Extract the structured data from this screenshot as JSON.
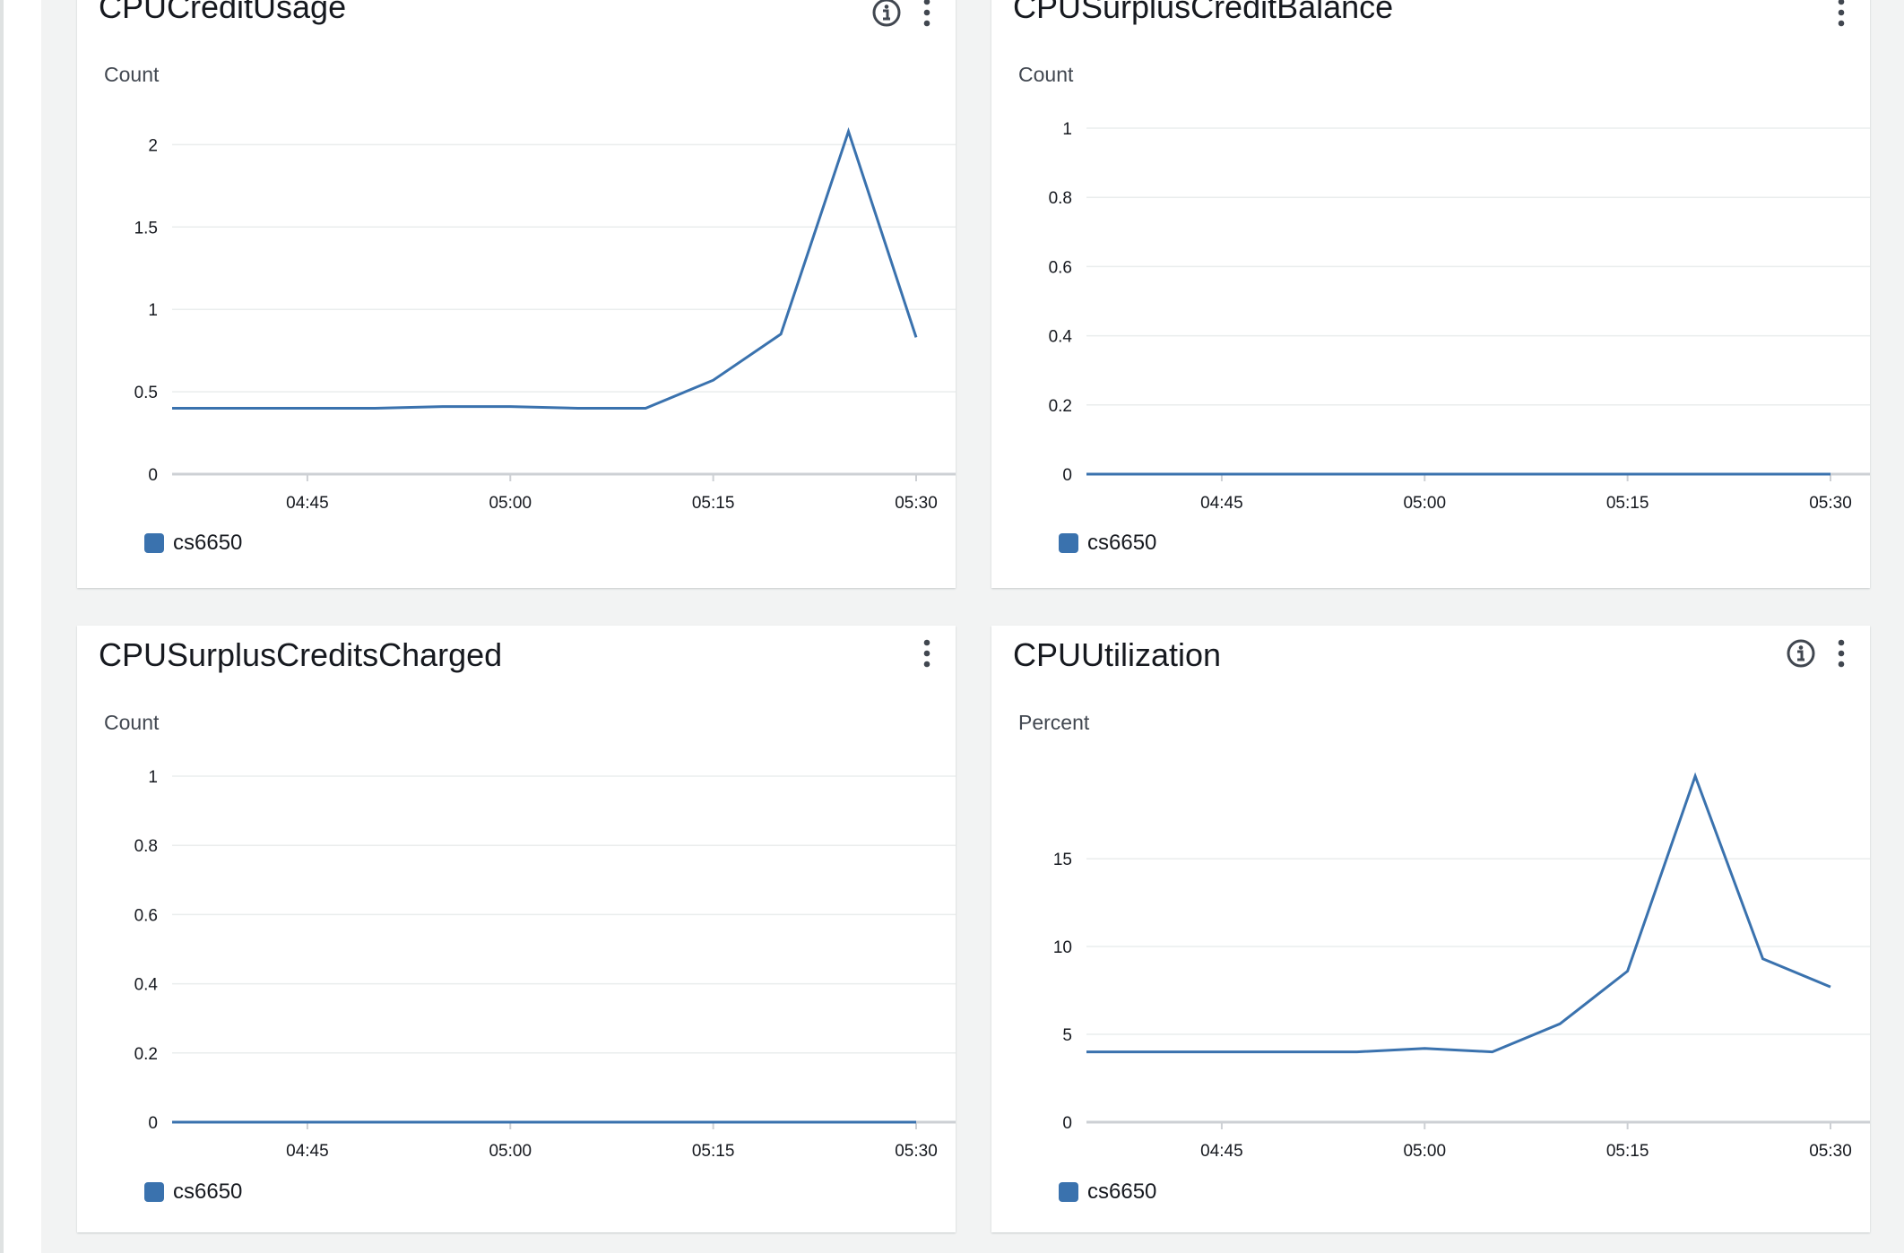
{
  "colors": {
    "series": "#3a72ae",
    "grid": "#eaeded",
    "baseline": "#cdd0d4",
    "text": "#16191f",
    "muted": "#414750"
  },
  "icons": {
    "info": "info-icon",
    "menu": "vertical-ellipsis-icon"
  },
  "widgets": [
    {
      "title": "CPUCreditUsage",
      "has_info": true,
      "legend": "cs6650",
      "chart_data": {
        "type": "line",
        "ylabel": "Count",
        "ylim": [
          0,
          2.1
        ],
        "yticks": [
          0,
          0.5,
          1,
          1.5,
          2
        ],
        "ytick_labels": [
          "0",
          "0.5",
          "1",
          "1.5",
          "2"
        ],
        "xlim": [
          "04:35",
          "04:55"
        ],
        "xticks": [
          "04:45",
          "05:00",
          "05:15",
          "05:30"
        ],
        "series": [
          {
            "name": "cs6650",
            "x": [
              "04:35",
              "04:40",
              "04:45",
              "04:50",
              "04:55",
              "05:00",
              "05:05",
              "05:10",
              "05:15",
              "05:20",
              "05:25",
              "05:30"
            ],
            "values": [
              0.4,
              0.4,
              0.4,
              0.4,
              0.41,
              0.41,
              0.4,
              0.4,
              0.57,
              0.85,
              2.08,
              0.83
            ]
          }
        ]
      }
    },
    {
      "title": "CPUSurplusCreditBalance",
      "has_info": false,
      "legend": "cs6650",
      "chart_data": {
        "type": "line",
        "ylabel": "Count",
        "ylim": [
          0,
          1
        ],
        "yticks": [
          0,
          0.2,
          0.4,
          0.6,
          0.8,
          1
        ],
        "ytick_labels": [
          "0",
          "0.2",
          "0.4",
          "0.6",
          "0.8",
          "1"
        ],
        "xticks": [
          "04:45",
          "05:00",
          "05:15",
          "05:30"
        ],
        "series": [
          {
            "name": "cs6650",
            "x": [
              "04:35",
              "04:40",
              "04:45",
              "04:50",
              "04:55",
              "05:00",
              "05:05",
              "05:10",
              "05:15",
              "05:20",
              "05:25",
              "05:30"
            ],
            "values": [
              0,
              0,
              0,
              0,
              0,
              0,
              0,
              0,
              0,
              0,
              0,
              0
            ]
          }
        ]
      }
    },
    {
      "title": "CPUSurplusCreditsCharged",
      "has_info": false,
      "legend": "cs6650",
      "chart_data": {
        "type": "line",
        "ylabel": "Count",
        "ylim": [
          0,
          1
        ],
        "yticks": [
          0,
          0.2,
          0.4,
          0.6,
          0.8,
          1
        ],
        "ytick_labels": [
          "0",
          "0.2",
          "0.4",
          "0.6",
          "0.8",
          "1"
        ],
        "xticks": [
          "04:45",
          "05:00",
          "05:15",
          "05:30"
        ],
        "series": [
          {
            "name": "cs6650",
            "x": [
              "04:35",
              "04:40",
              "04:45",
              "04:50",
              "04:55",
              "05:00",
              "05:05",
              "05:10",
              "05:15",
              "05:20",
              "05:25",
              "05:30"
            ],
            "values": [
              0,
              0,
              0,
              0,
              0,
              0,
              0,
              0,
              0,
              0,
              0,
              0
            ]
          }
        ]
      }
    },
    {
      "title": "CPUUtilization",
      "has_info": true,
      "legend": "cs6650",
      "chart_data": {
        "type": "line",
        "ylabel": "Percent",
        "ylim": [
          0,
          19.7
        ],
        "yticks": [
          0,
          5,
          10,
          15
        ],
        "ytick_labels": [
          "0",
          "5",
          "10",
          "15"
        ],
        "xticks": [
          "04:45",
          "05:00",
          "05:15",
          "05:30"
        ],
        "series": [
          {
            "name": "cs6650",
            "x": [
              "04:35",
              "04:40",
              "04:45",
              "04:50",
              "04:55",
              "05:00",
              "05:05",
              "05:10",
              "05:15",
              "05:20",
              "05:25",
              "05:30"
            ],
            "values": [
              4.0,
              4.0,
              4.0,
              4.0,
              4.0,
              4.2,
              4.0,
              5.6,
              8.6,
              19.7,
              9.3,
              7.7
            ]
          }
        ]
      }
    }
  ]
}
